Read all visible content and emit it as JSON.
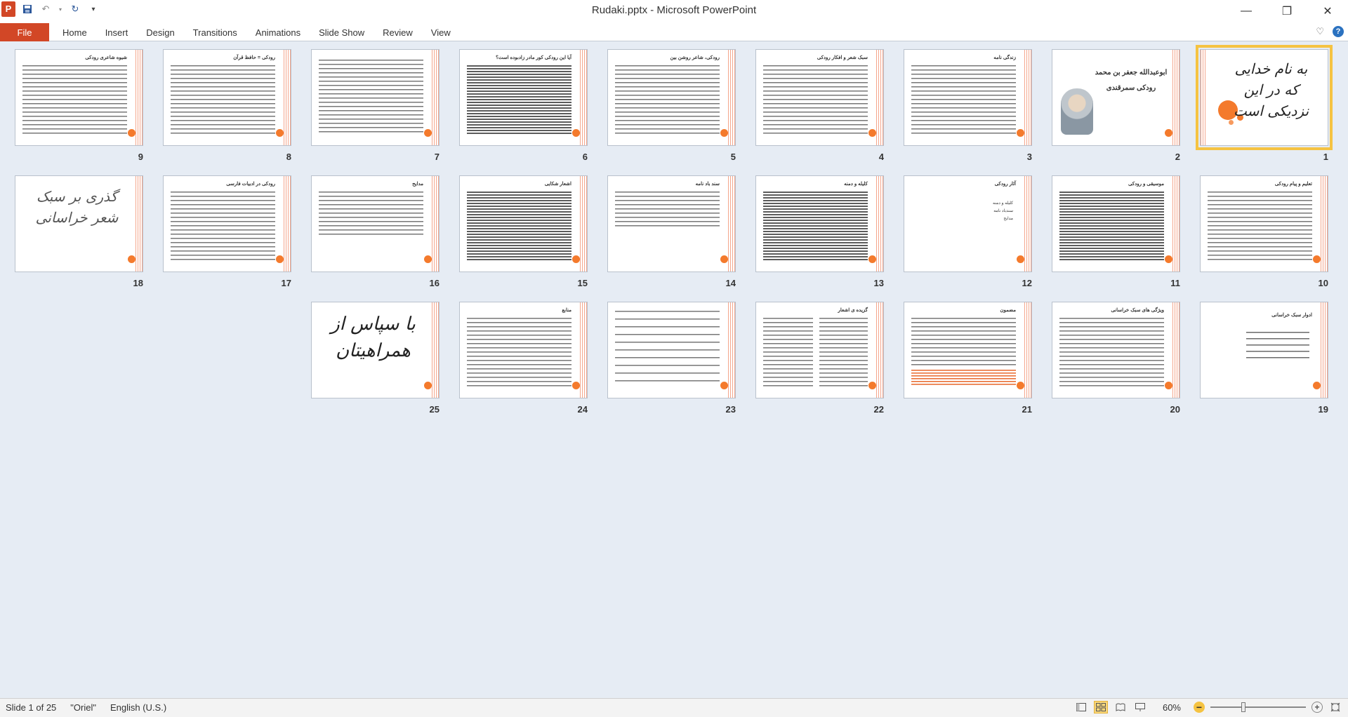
{
  "window": {
    "title": "Rudaki.pptx  -  Microsoft PowerPoint"
  },
  "ribbon": {
    "file_tab": "File",
    "tabs": [
      "Home",
      "Insert",
      "Design",
      "Transitions",
      "Animations",
      "Slide Show",
      "Review",
      "View"
    ]
  },
  "slides": {
    "s1": {
      "number": "1",
      "text": "به نام خدایی که در این نزدیکی است"
    },
    "s2": {
      "number": "2",
      "line1": "ابوعبدالله جعفر بن محمد",
      "line2": "رودکی سمرقندی"
    },
    "s3": {
      "number": "3",
      "title": "زندگی نامه"
    },
    "s4": {
      "number": "4",
      "title": "سبک شعر و افکار رودکی"
    },
    "s5": {
      "number": "5",
      "title": "رودکی، شاعر روشن بین"
    },
    "s6": {
      "number": "6",
      "title": "آیا این رودکی کور مادر زادبوده است؟"
    },
    "s7": {
      "number": "7",
      "title": ""
    },
    "s8": {
      "number": "8",
      "title": "رودکی = حافظ قرآن"
    },
    "s9": {
      "number": "9",
      "title": "شیوه شاعری رودکی"
    },
    "s10": {
      "number": "10",
      "title": "تعلیم و پیام رودکی"
    },
    "s11": {
      "number": "11",
      "title": "موسیقی و رودکی"
    },
    "s12": {
      "number": "12",
      "title": "آثار رودکی",
      "items": [
        "کلیله و دمنه",
        "سندباد نامه",
        "مدایح"
      ]
    },
    "s13": {
      "number": "13",
      "title": "کلیله و دمنه"
    },
    "s14": {
      "number": "14",
      "title": "سند باد نامه"
    },
    "s15": {
      "number": "15",
      "title": "اشعار شکایی"
    },
    "s16": {
      "number": "16",
      "title": "مدایح"
    },
    "s17": {
      "number": "17",
      "title": "رودکی در ادبیات فارسی"
    },
    "s18": {
      "number": "18",
      "text": "گذری بر سبک شعر خراسانی"
    },
    "s19": {
      "number": "19",
      "title": "ادوار سبک خراسانی"
    },
    "s20": {
      "number": "20",
      "title": "ویژگی های سبک خراسانی"
    },
    "s21": {
      "number": "21",
      "title": "مضمون"
    },
    "s22": {
      "number": "22",
      "title": "گزیده ی اشعار"
    },
    "s23": {
      "number": "23",
      "title": ""
    },
    "s24": {
      "number": "24",
      "title": "منابع"
    },
    "s25": {
      "number": "25",
      "text": "با سپاس از همراهیتان"
    }
  },
  "status": {
    "slide_info": "Slide 1 of 25",
    "theme": "\"Oriel\"",
    "language": "English (U.S.)",
    "zoom": "60%"
  }
}
